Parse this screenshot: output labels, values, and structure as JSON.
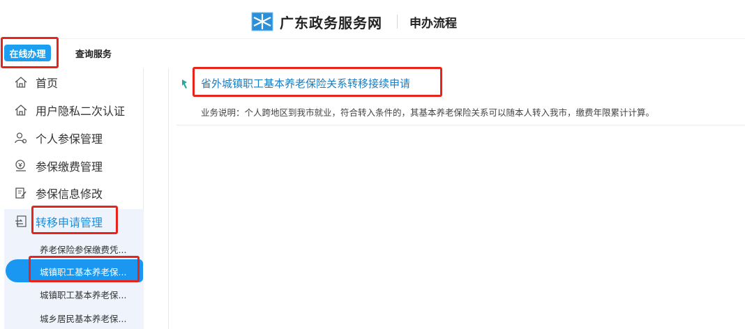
{
  "header": {
    "brand_name": "广东政务服务网",
    "subtitle": "申办流程"
  },
  "tabs": {
    "online": "在线办理",
    "query": "查询服务"
  },
  "sidebar": {
    "items": [
      {
        "label": "首页",
        "icon": "home-icon"
      },
      {
        "label": "用户隐私二次认证",
        "icon": "home-icon"
      },
      {
        "label": "个人参保管理",
        "icon": "user-group-icon"
      },
      {
        "label": "参保缴费管理",
        "icon": "payment-icon"
      },
      {
        "label": "参保信息修改",
        "icon": "edit-icon"
      },
      {
        "label": "转移申请管理",
        "icon": "transfer-icon"
      }
    ],
    "sub_items": [
      "养老保险参保缴费凭...",
      "城镇职工基本养老保...",
      "城镇职工基本养老保...",
      "城乡居民基本养老保..."
    ]
  },
  "main": {
    "service_title": "省外城镇职工基本养老保险关系转移接续申请",
    "service_desc": "业务说明：个人跨地区到我市就业，符合转入条件的，其基本养老保险关系可以随本人转入我市，缴费年限累计计算。"
  },
  "colors": {
    "accent": "#1a97f0",
    "highlight": "#e8231a",
    "title_link": "#1a7dc2"
  }
}
